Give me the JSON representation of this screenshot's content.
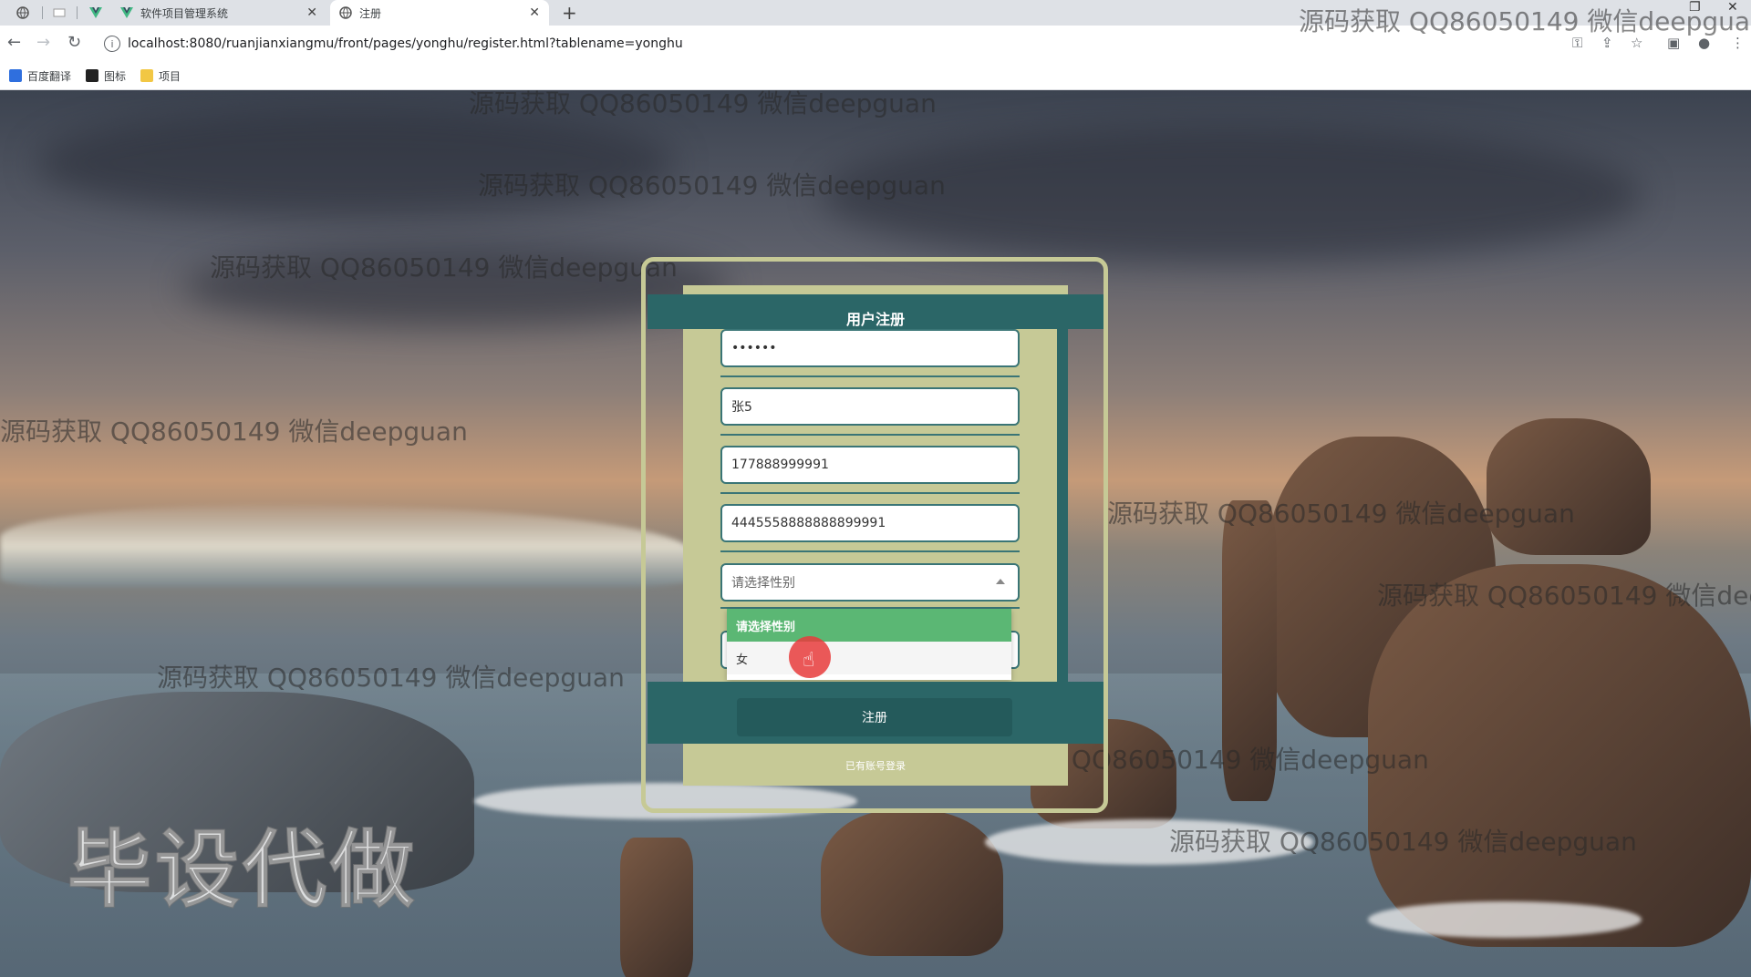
{
  "browser": {
    "tabs": [
      {
        "label": ""
      },
      {
        "label": ""
      },
      {
        "label": "软件项目管理系统"
      },
      {
        "label": "注册",
        "active": true
      }
    ],
    "url": "localhost:8080/ruanjianxiangmu/front/pages/yonghu/register.html?tablename=yonghu",
    "bookmarks": [
      {
        "label": "百度翻译",
        "color": "#2f6fde"
      },
      {
        "label": "图标",
        "color": "#222222"
      },
      {
        "label": "项目",
        "color": "#f2c744"
      }
    ]
  },
  "form": {
    "title": "用户注册",
    "password_value": "••••••",
    "name_value": "张5",
    "phone_value": "177888999991",
    "idcard_value": "4445558888888899991",
    "gender_placeholder": "请选择性别",
    "gender_options": [
      "请选择性别",
      "女"
    ],
    "register_button": "注册",
    "login_link": "已有账号登录"
  },
  "watermarks": [
    "源码获取 QQ86050149 微信deepguan",
    "毕设代做"
  ],
  "colors": {
    "panel": "#c6c996",
    "accent": "#2b6667",
    "selected_option": "#5bb774"
  }
}
